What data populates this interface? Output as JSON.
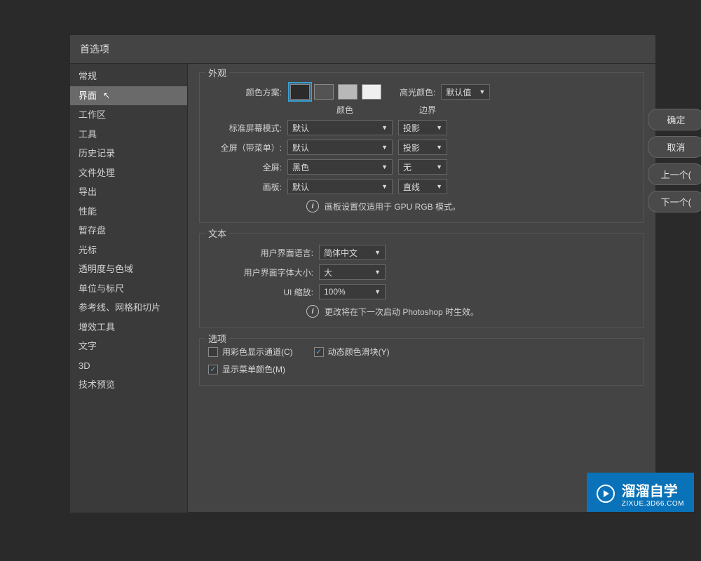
{
  "window": {
    "title": "首选项"
  },
  "sidebar": {
    "items": [
      "常规",
      "界面",
      "工作区",
      "工具",
      "历史记录",
      "文件处理",
      "导出",
      "性能",
      "暂存盘",
      "光标",
      "透明度与色域",
      "单位与标尺",
      "参考线、网格和切片",
      "增效工具",
      "文字",
      "3D",
      "技术预览"
    ],
    "selected_index": 1
  },
  "buttons": {
    "ok": "确定",
    "cancel": "取消",
    "prev": "上一个(",
    "next": "下一个("
  },
  "appearance": {
    "title": "外观",
    "color_scheme_label": "颜色方案:",
    "highlight_label": "高光颜色:",
    "highlight_value": "默认值",
    "col_color": "颜色",
    "col_border": "边界",
    "rows": [
      {
        "label": "标准屏幕模式:",
        "color": "默认",
        "border": "投影"
      },
      {
        "label": "全屏（带菜单）:",
        "color": "默认",
        "border": "投影"
      },
      {
        "label": "全屏:",
        "color": "黑色",
        "border": "无"
      },
      {
        "label": "画板:",
        "color": "默认",
        "border": "直线"
      }
    ],
    "note": "画板设置仅适用于 GPU RGB 模式。"
  },
  "text": {
    "title": "文本",
    "lang_label": "用户界面语言:",
    "lang_value": "简体中文",
    "font_label": "用户界面字体大小:",
    "font_value": "大",
    "scale_label": "UI 缩放:",
    "scale_value": "100%",
    "note": "更改将在下一次启动 Photoshop 时生效。"
  },
  "options": {
    "title": "选项",
    "color_channels": "用彩色显示通道(C)",
    "dynamic_sliders": "动态颜色滑块(Y)",
    "show_menu_colors": "显示菜单颜色(M)"
  },
  "watermark": {
    "brand": "溜溜自学",
    "url": "ZIXUE.3D66.COM"
  }
}
